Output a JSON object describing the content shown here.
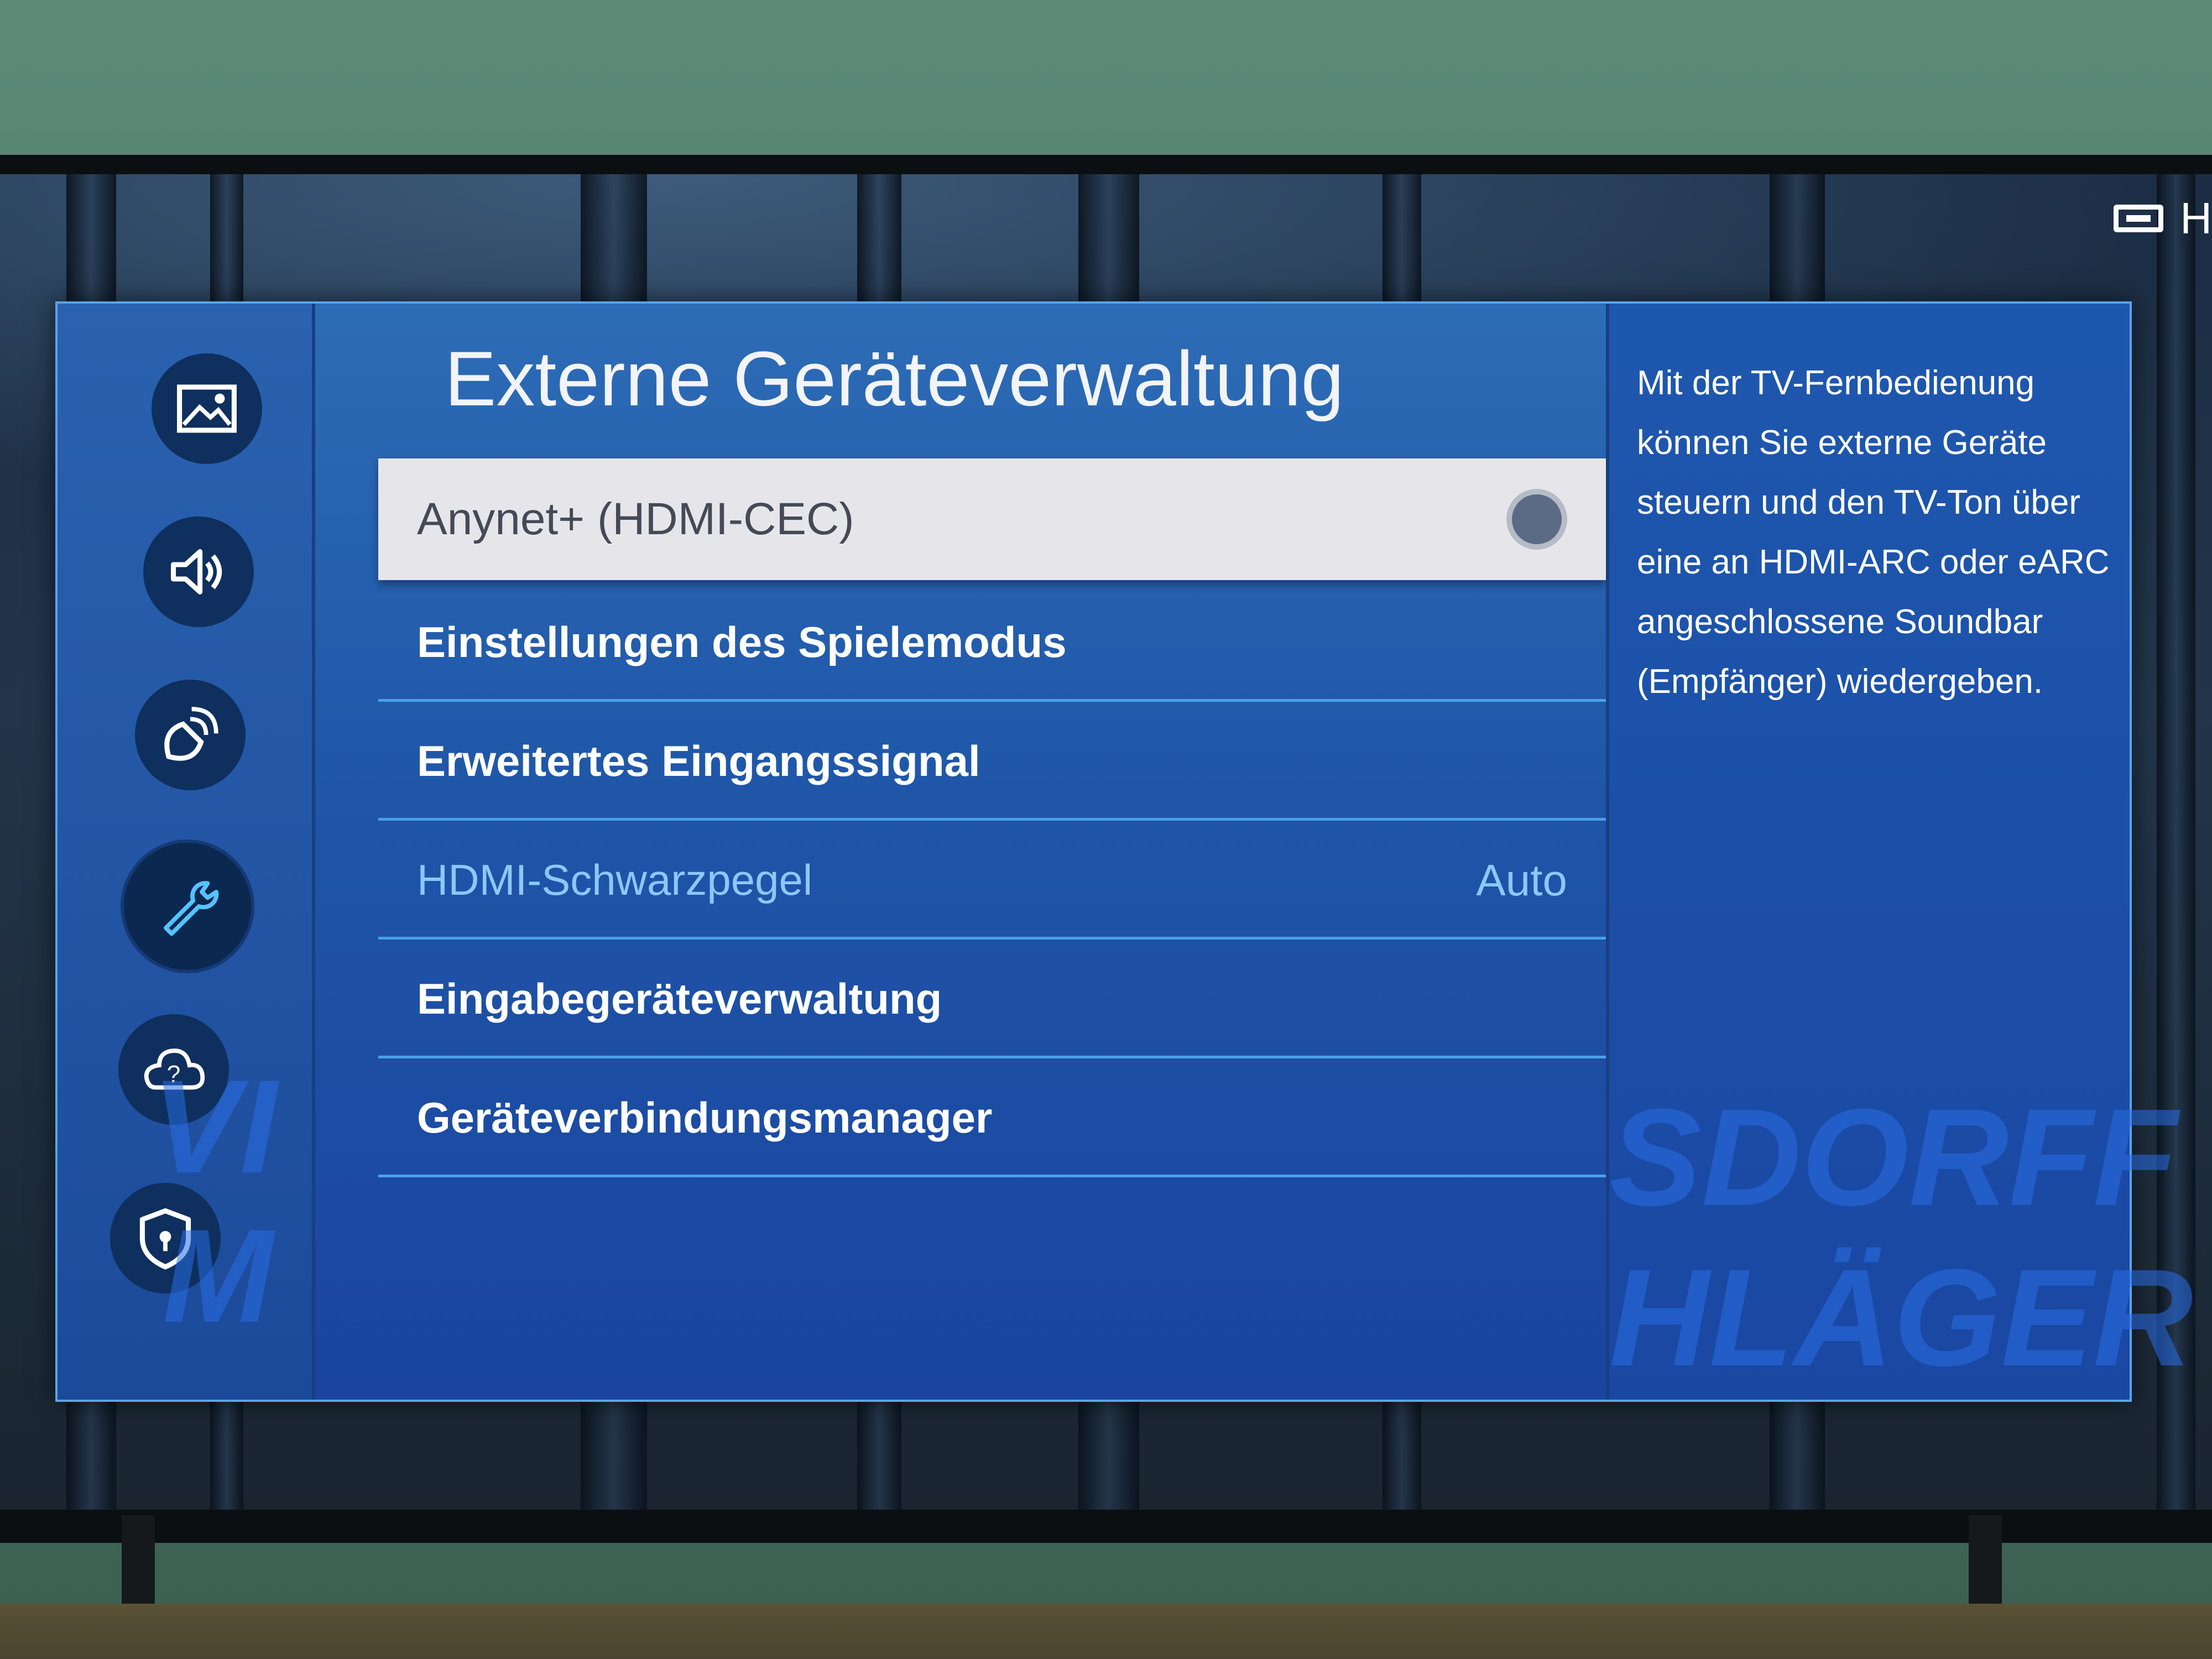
{
  "input_indicator": {
    "label": "H",
    "icon": "hdmi-icon"
  },
  "nav_rail": {
    "items": [
      {
        "name": "picture",
        "icon": "picture-icon"
      },
      {
        "name": "sound",
        "icon": "sound-icon"
      },
      {
        "name": "broadcast",
        "icon": "broadcast-icon"
      },
      {
        "name": "general",
        "icon": "wrench-icon",
        "active": true
      },
      {
        "name": "support",
        "icon": "cloud-help-icon"
      },
      {
        "name": "privacy",
        "icon": "shield-icon"
      }
    ]
  },
  "menu": {
    "title": "Externe Geräteverwaltung",
    "items": [
      {
        "label": "Anynet+ (HDMI-CEC)",
        "focused": true,
        "toggle": "on"
      },
      {
        "label": "Einstellungen des Spielemodus"
      },
      {
        "label": "Erweitertes Eingangssignal"
      },
      {
        "label": "HDMI-Schwarzpegel",
        "value": "Auto",
        "dimmed": true
      },
      {
        "label": "Eingabegeräteverwaltung"
      },
      {
        "label": "Geräteverbindungsmanager"
      }
    ]
  },
  "description": {
    "text": "Mit der TV-Fernbedienung können Sie externe Geräte steuern und den TV-Ton über eine an HDMI-ARC oder eARC angeschlossene Soundbar (Empfänger) wiedergeben."
  },
  "background_text": {
    "line1": "SDORFF",
    "line2": "HLÄGER",
    "left1": "VI",
    "left2": "M"
  },
  "colors": {
    "panel": "#1f56a8",
    "focused_item": "#e6e6ea",
    "accent_dim": "#8cc8ff",
    "divider": "#4aa0ea"
  }
}
